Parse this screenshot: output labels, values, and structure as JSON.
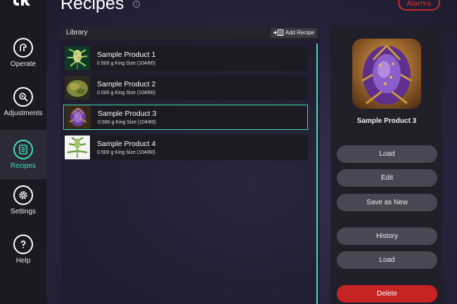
{
  "header": {
    "title": "Recipes",
    "info_icon": "info-icon",
    "alarms_label": "Alarms"
  },
  "sidebar": {
    "logo": "jr-logo",
    "items": [
      {
        "label": "Operate",
        "icon": "operate-icon",
        "active": false
      },
      {
        "label": "Adjustments",
        "icon": "adjustments-icon",
        "active": false
      },
      {
        "label": "Recipes",
        "icon": "recipes-icon",
        "active": true
      },
      {
        "label": "Settings",
        "icon": "settings-icon",
        "active": false
      },
      {
        "label": "Help",
        "icon": "help-icon",
        "active": false
      }
    ]
  },
  "library": {
    "title": "Library",
    "add_label": "Add Recipe",
    "products": [
      {
        "name": "Sample Product 1",
        "meta": "0.500 g  King Size (104/80)",
        "selected": false
      },
      {
        "name": "Sample Product 2",
        "meta": "0.500 g  King Size (104/80)",
        "selected": false
      },
      {
        "name": "Sample Product 3",
        "meta": "0.500 g  King Size (104/80)",
        "selected": true
      },
      {
        "name": "Sample Product 4",
        "meta": "0.500 g  King Size (104/80)",
        "selected": false
      }
    ]
  },
  "detail": {
    "name": "Sample Product 3",
    "buttons": {
      "load": "Load",
      "edit": "Edit",
      "save_as_new": "Save as New",
      "history": "History",
      "load2": "Load",
      "delete": "Delete"
    }
  },
  "colors": {
    "accent": "#3ee0b4",
    "danger": "#c62424",
    "sidebar_bg": "#1b1a22"
  }
}
